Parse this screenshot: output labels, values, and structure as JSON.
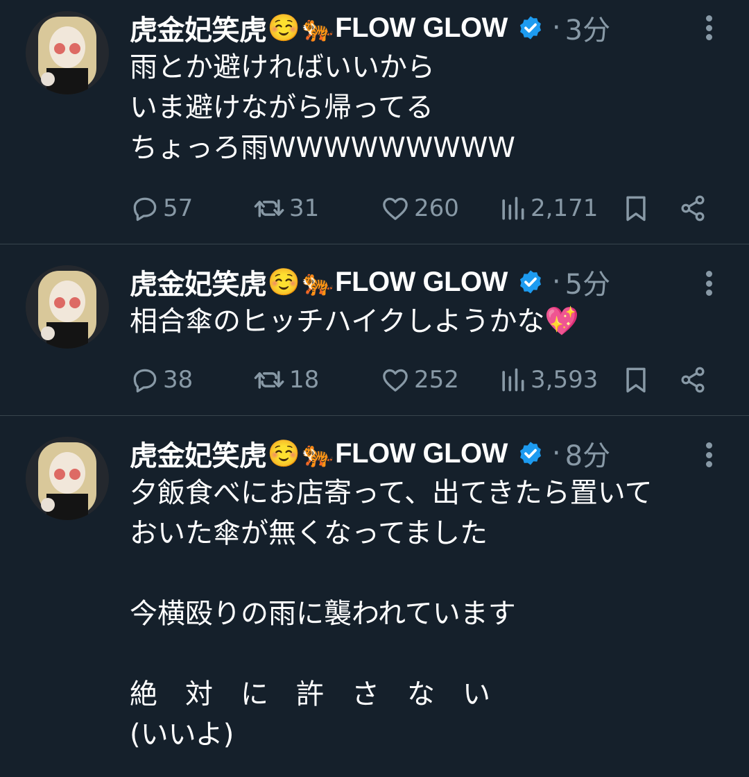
{
  "tweets": [
    {
      "name": "虎金妃笑虎",
      "emoji": [
        "☺️",
        "🐅"
      ],
      "suffix": "FLOW GLOW",
      "dot": "·",
      "time": "3分",
      "text": "雨とか避ければいいから\nいま避けながら帰ってる\nちょっろ雨WWWWWWWWW",
      "replies": "57",
      "retweets": "31",
      "likes": "260",
      "views": "2,171"
    },
    {
      "name": "虎金妃笑虎",
      "emoji": [
        "☺️",
        "🐅"
      ],
      "suffix": "FLOW GLOW",
      "dot": "·",
      "time": "5分",
      "text": "相合傘のヒッチハイクしようかな💖",
      "replies": "38",
      "retweets": "18",
      "likes": "252",
      "views": "3,593"
    },
    {
      "name": "虎金妃笑虎",
      "emoji": [
        "☺️",
        "🐅"
      ],
      "suffix": "FLOW GLOW",
      "dot": "·",
      "time": "8分",
      "text": "夕飯食べにお店寄って、出てきたら置いて\nおいた傘が無くなってました\n\n今横殴りの雨に襲われています\n\n絶　対　に　許　さ　な　い\n(いいよ)"
    }
  ],
  "icons": {
    "verified": "verified-badge-icon",
    "more": "more-vertical-icon",
    "reply": "reply-icon",
    "retweet": "retweet-icon",
    "like": "heart-icon",
    "views": "views-icon",
    "bookmark": "bookmark-icon",
    "share": "share-icon"
  },
  "colors": {
    "background": "#15202b",
    "muted": "#8899a6",
    "verified": "#1d9bf0",
    "divider": "#38444d"
  }
}
